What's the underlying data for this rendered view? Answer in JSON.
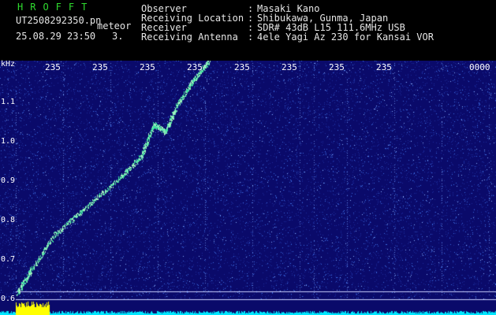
{
  "header": {
    "brand": "HROFFT",
    "filename": "UT2508292350.pn",
    "mode": "meteor",
    "datetime": "25.08.29 23:50",
    "count": "3.",
    "rows": [
      {
        "key": "Observer",
        "value": "Masaki Kano"
      },
      {
        "key": "Receiving Location",
        "value": "Shibukawa, Gunma, Japan"
      },
      {
        "key": "Receiver",
        "value": "SDR# 43dB L15 111.6MHz USB"
      },
      {
        "key": "Receiving Antenna",
        "value": "4ele Yagi Az 230 for Kansai VOR"
      }
    ],
    "separator": ":"
  },
  "spectrogram": {
    "unit": "kHz",
    "y_ticks": [
      "1.1",
      "1.0",
      "0.9",
      "0.8",
      "0.7",
      "0.6"
    ],
    "x_ticks": [
      "235",
      "235",
      "235",
      "235",
      "235",
      "235",
      "235",
      "235",
      "0000"
    ],
    "colors": {
      "background": "#0a0a6a",
      "noise_low": "#1a2a9a",
      "noise_high": "#3a6ae0",
      "echo": "#9ff0c0",
      "gridline": "#c8d0ff",
      "trace_yellow": "#ffff00",
      "trace_cyan": "#00e8ff"
    }
  }
}
